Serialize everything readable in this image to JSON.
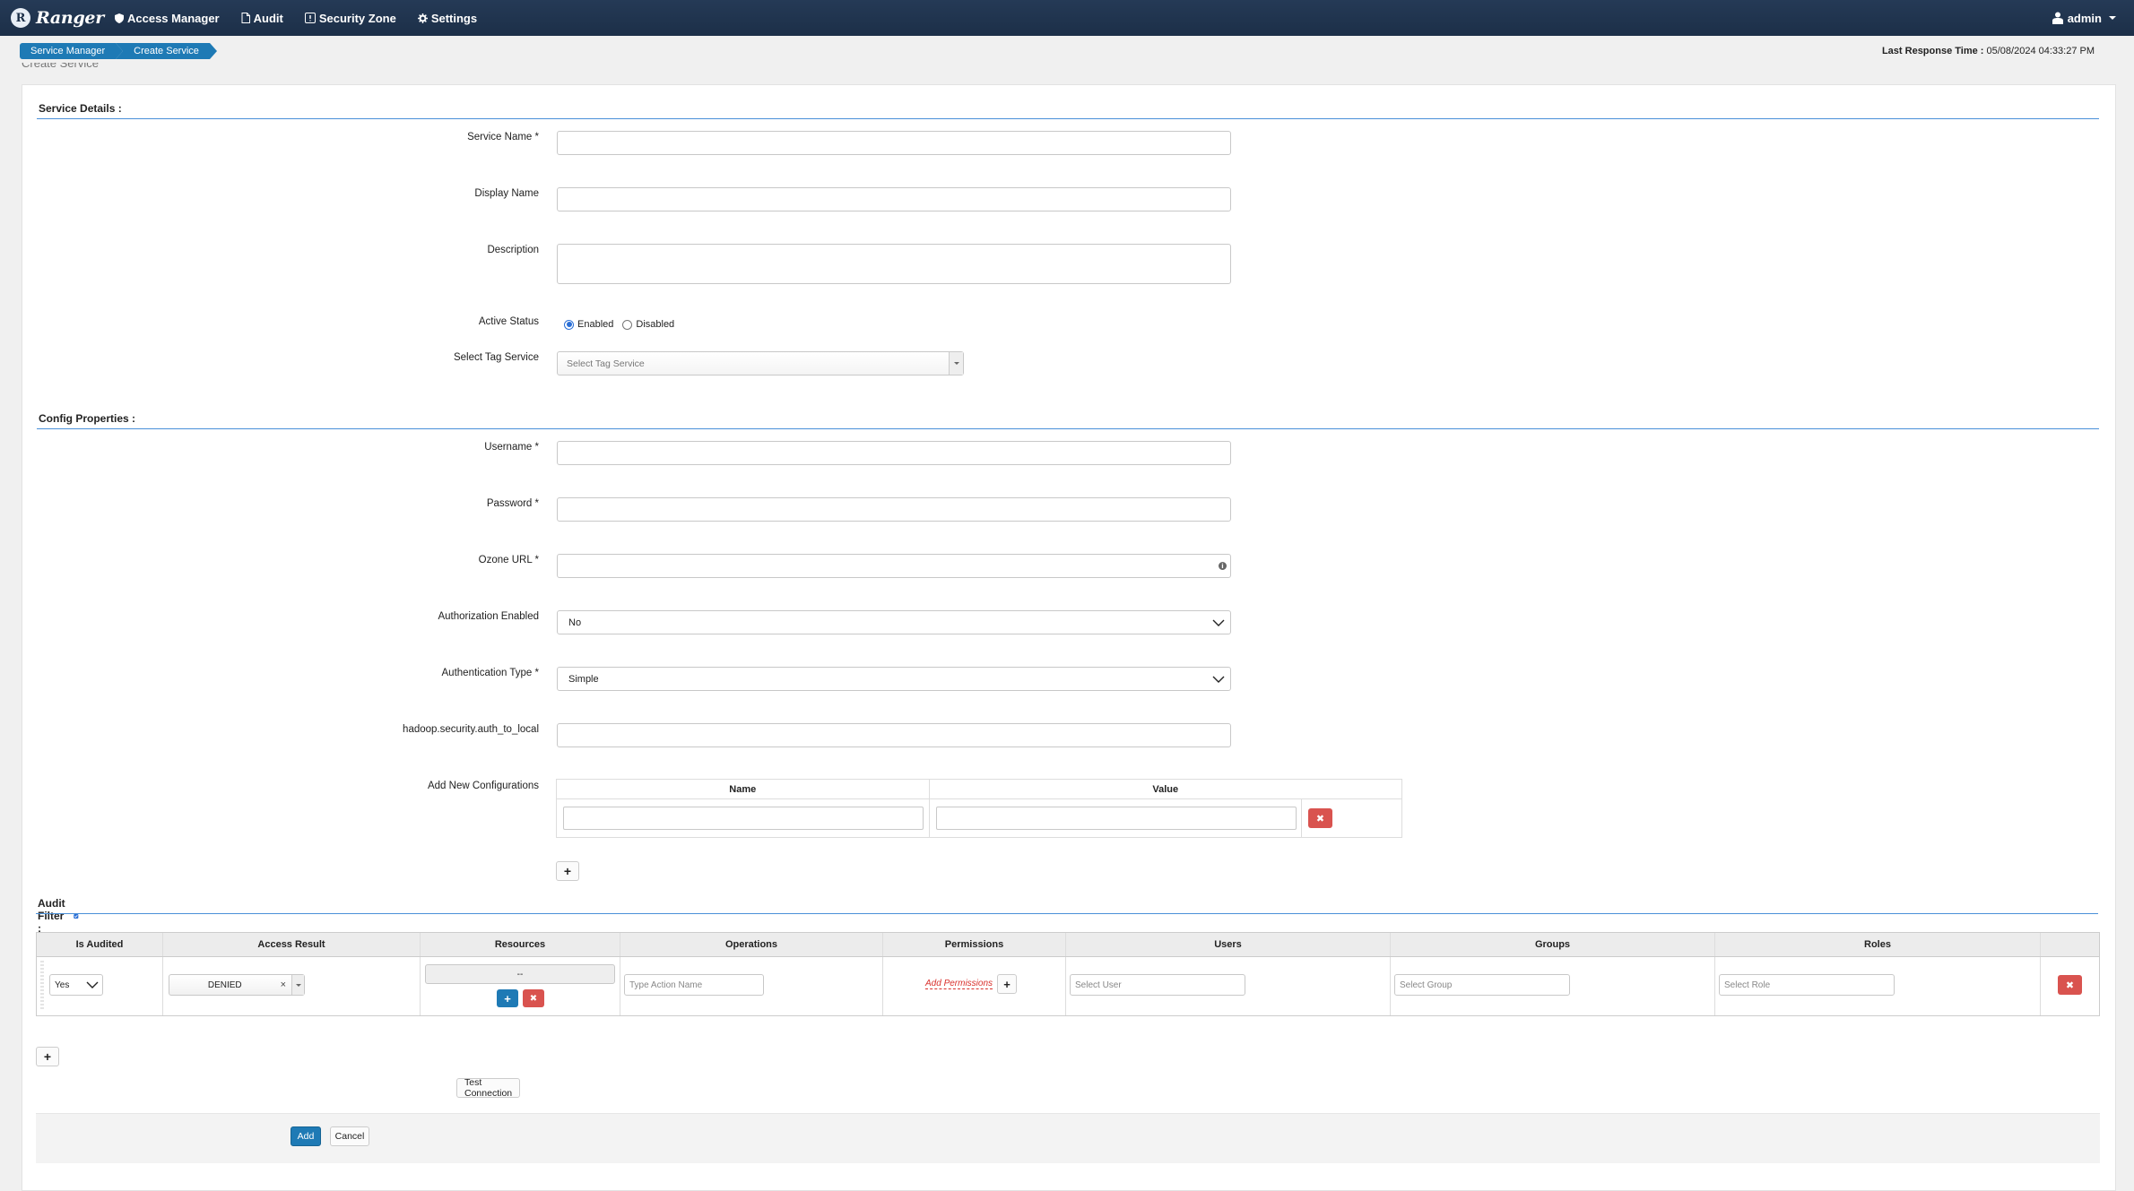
{
  "navbar": {
    "brand": "Ranger",
    "brand_logo": "R",
    "items": [
      {
        "label": "Access Manager",
        "icon": "shield-icon"
      },
      {
        "label": "Audit",
        "icon": "file-icon"
      },
      {
        "label": "Security Zone",
        "icon": "zone-icon"
      },
      {
        "label": "Settings",
        "icon": "gear-icon"
      }
    ],
    "user": "admin"
  },
  "breadcrumb": [
    "Service Manager",
    "Create Service"
  ],
  "last_response": {
    "label": "Last Response Time :",
    "value": "05/08/2024 04:33:27 PM"
  },
  "page_title": "Create Service",
  "service_details": {
    "title": "Service Details :",
    "service_name_label": "Service Name *",
    "display_name_label": "Display Name",
    "description_label": "Description",
    "active_status_label": "Active Status",
    "enabled_label": "Enabled",
    "disabled_label": "Disabled",
    "active_status_value": "Enabled",
    "tag_service_label": "Select Tag Service",
    "tag_service_placeholder": "Select Tag Service"
  },
  "config": {
    "title": "Config Properties :",
    "username_label": "Username *",
    "password_label": "Password *",
    "ozone_url_label": "Ozone URL *",
    "auth_enabled_label": "Authorization Enabled",
    "auth_enabled_value": "No",
    "auth_type_label": "Authentication Type *",
    "auth_type_value": "Simple",
    "auth_to_local_label": "hadoop.security.auth_to_local",
    "add_new_label": "Add New Configurations",
    "table_headers": [
      "Name",
      "Value"
    ],
    "delete_glyph": "✖",
    "add_glyph": "+"
  },
  "audit_filter": {
    "title": "Audit Filter :",
    "checked": true,
    "headers": [
      "Is Audited",
      "Access Result",
      "Resources",
      "Operations",
      "Permissions",
      "Users",
      "Groups",
      "Roles",
      ""
    ],
    "row": {
      "is_audited": "Yes",
      "access_result": "DENIED",
      "access_result_clear": "×",
      "resources": "--",
      "operations_placeholder": "Type Action Name",
      "add_permissions": "Add Permissions",
      "users_placeholder": "Select User",
      "groups_placeholder": "Select Group",
      "roles_placeholder": "Select Role"
    }
  },
  "buttons": {
    "test_connection": "Test Connection",
    "add": "Add",
    "cancel": "Cancel"
  },
  "colors": {
    "navbar": "#1c2f48",
    "accent": "#1e7ab5",
    "danger": "#d9534f",
    "section_rule": "#4a90d9"
  }
}
